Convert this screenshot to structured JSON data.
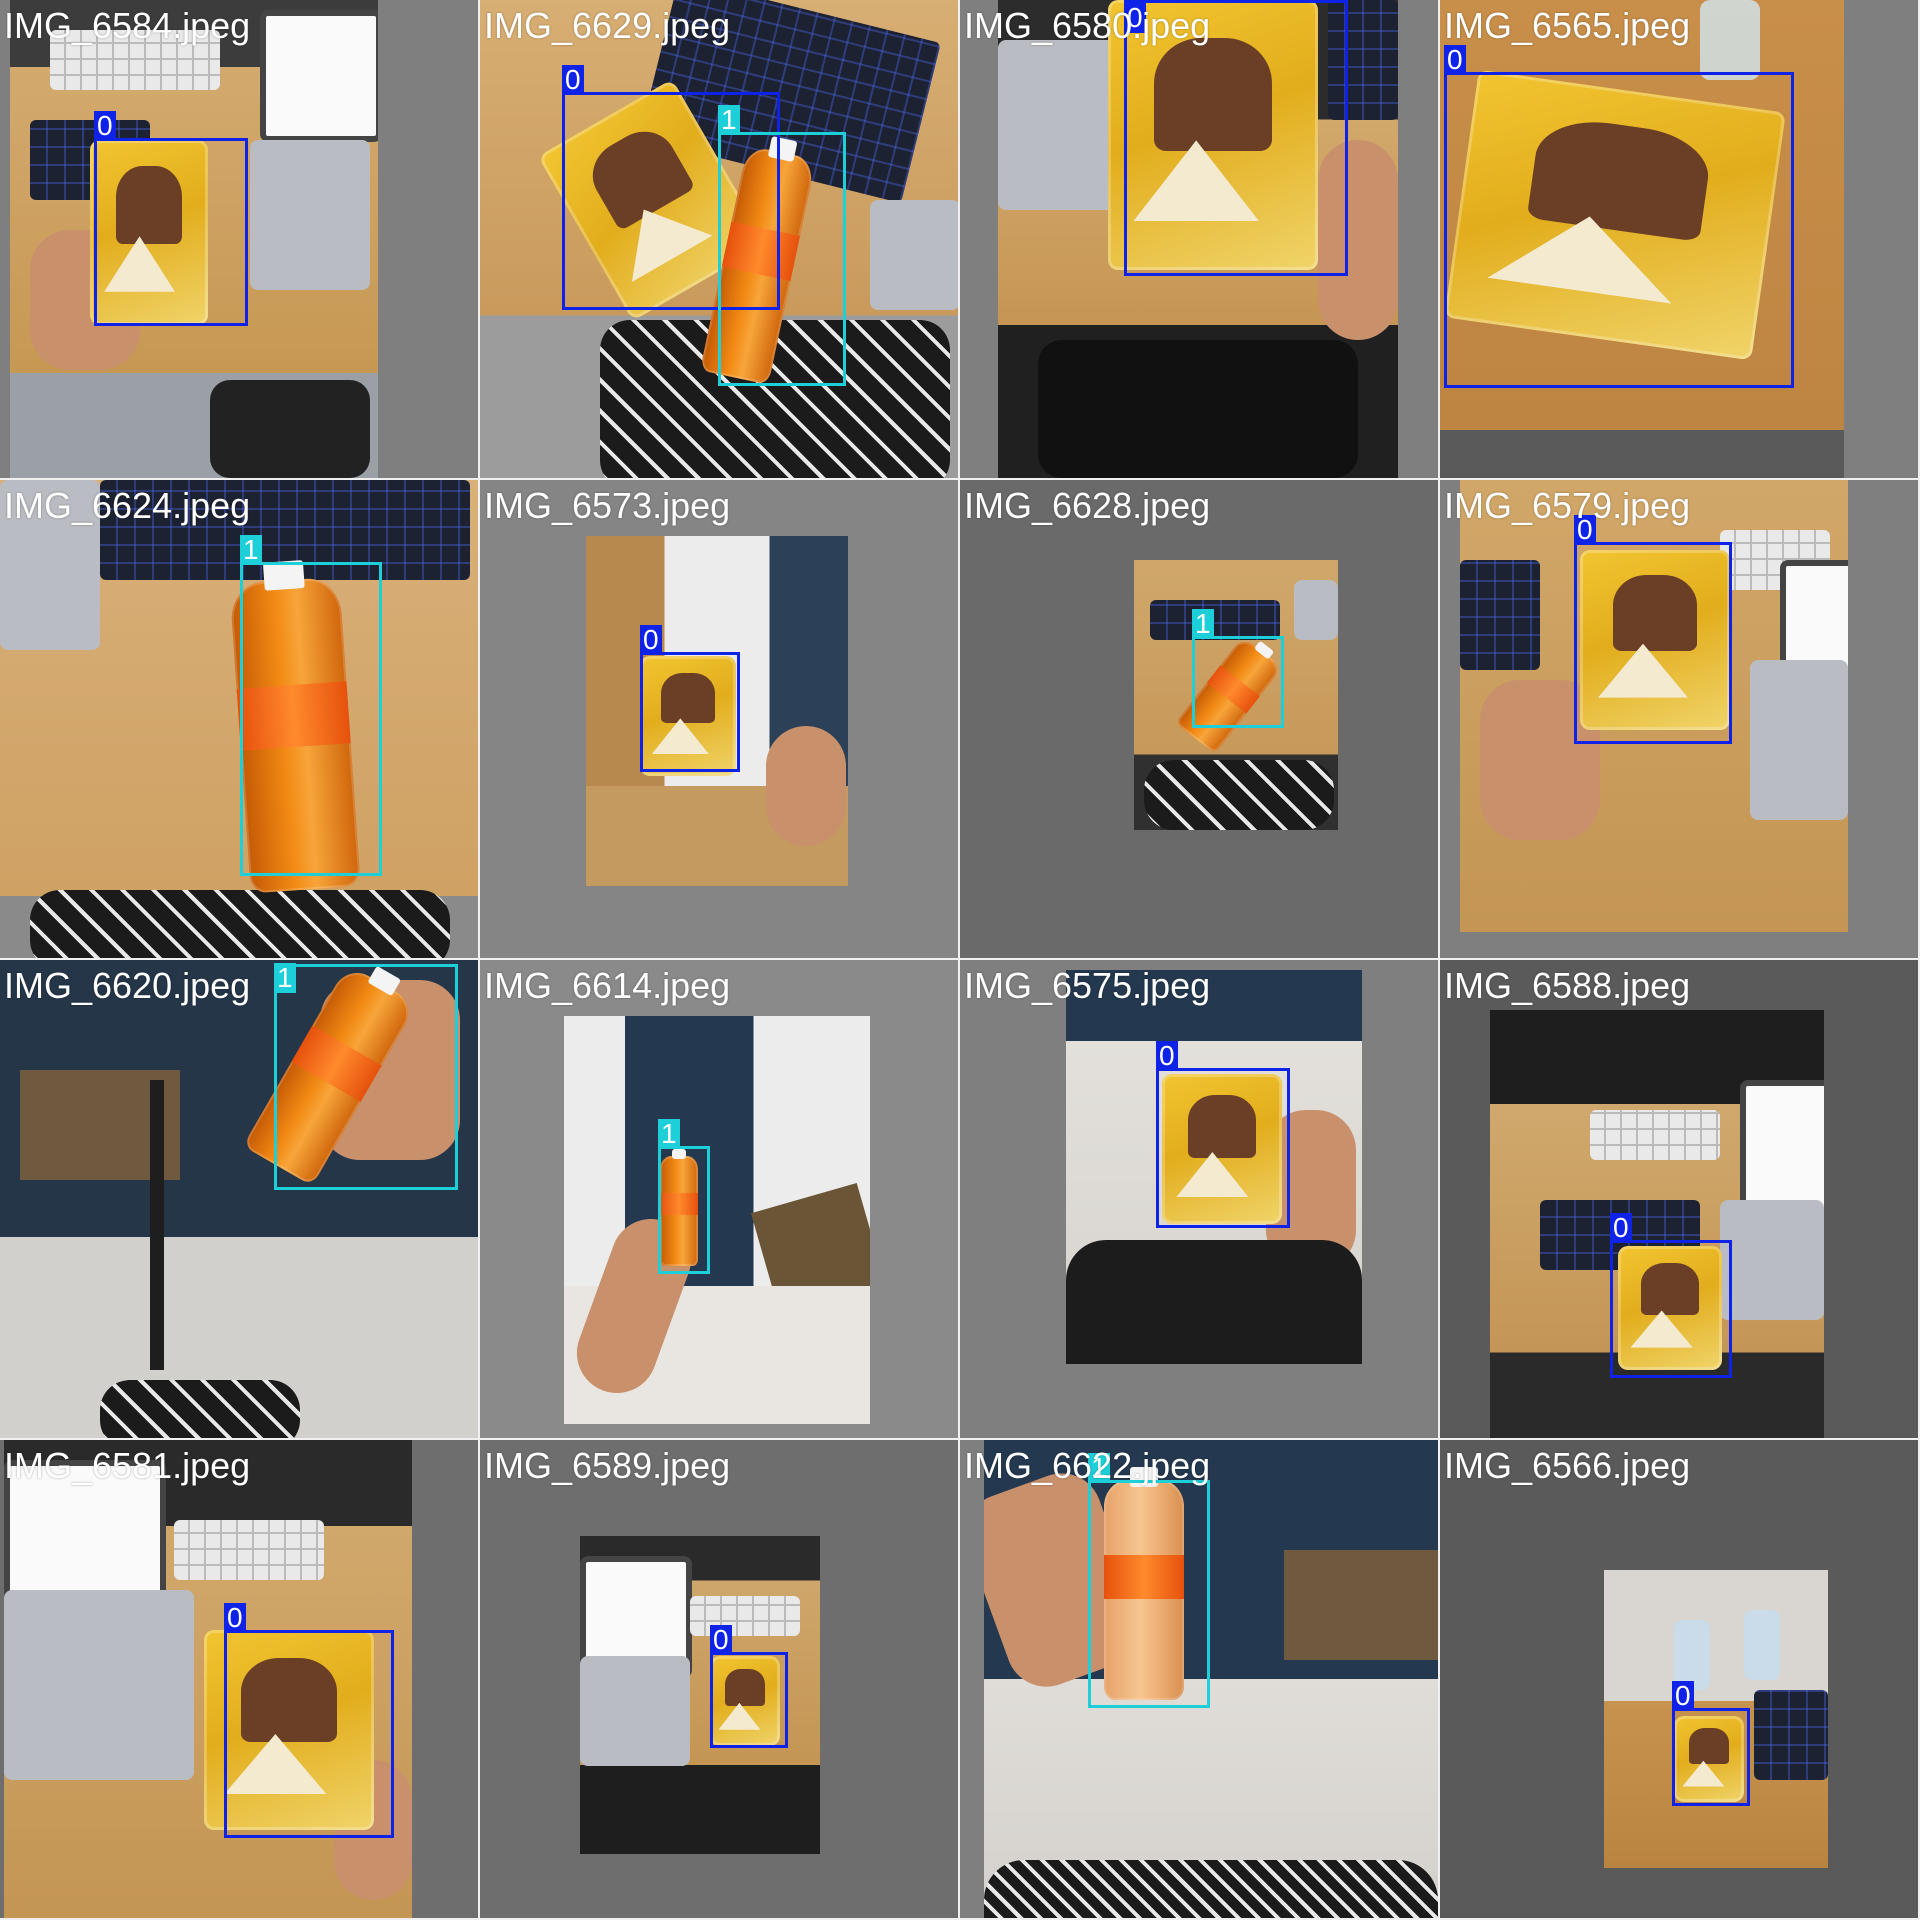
{
  "colors": {
    "class_0_box": "#0f23e8",
    "class_1_box": "#1ccfd8",
    "caption_text": "#ffffff",
    "letterbox_gray": "#7f7f7f"
  },
  "tiles": [
    {
      "filename": "IMG_6584.jpeg",
      "detections": [
        {
          "class_label": "0",
          "class_id": 0
        }
      ]
    },
    {
      "filename": "IMG_6629.jpeg",
      "detections": [
        {
          "class_label": "0",
          "class_id": 0
        },
        {
          "class_label": "1",
          "class_id": 1
        }
      ]
    },
    {
      "filename": "IMG_6580.jpeg",
      "detections": [
        {
          "class_label": "0",
          "class_id": 0
        }
      ]
    },
    {
      "filename": "IMG_6565.jpeg",
      "detections": [
        {
          "class_label": "0",
          "class_id": 0
        }
      ]
    },
    {
      "filename": "IMG_6624.jpeg",
      "detections": [
        {
          "class_label": "1",
          "class_id": 1
        }
      ]
    },
    {
      "filename": "IMG_6573.jpeg",
      "detections": [
        {
          "class_label": "0",
          "class_id": 0
        }
      ]
    },
    {
      "filename": "IMG_6628.jpeg",
      "detections": [
        {
          "class_label": "1",
          "class_id": 1
        }
      ]
    },
    {
      "filename": "IMG_6579.jpeg",
      "detections": [
        {
          "class_label": "0",
          "class_id": 0
        }
      ]
    },
    {
      "filename": "IMG_6620.jpeg",
      "detections": [
        {
          "class_label": "1",
          "class_id": 1
        }
      ]
    },
    {
      "filename": "IMG_6614.jpeg",
      "detections": [
        {
          "class_label": "1",
          "class_id": 1
        }
      ]
    },
    {
      "filename": "IMG_6575.jpeg",
      "detections": [
        {
          "class_label": "0",
          "class_id": 0
        }
      ]
    },
    {
      "filename": "IMG_6588.jpeg",
      "detections": [
        {
          "class_label": "0",
          "class_id": 0
        }
      ]
    },
    {
      "filename": "IMG_6581.jpeg",
      "detections": [
        {
          "class_label": "0",
          "class_id": 0
        }
      ]
    },
    {
      "filename": "IMG_6589.jpeg",
      "detections": [
        {
          "class_label": "0",
          "class_id": 0
        }
      ]
    },
    {
      "filename": "IMG_6622.jpeg",
      "detections": [
        {
          "class_label": "1",
          "class_id": 1
        }
      ]
    },
    {
      "filename": "IMG_6566.jpeg",
      "detections": [
        {
          "class_label": "0",
          "class_id": 0
        }
      ]
    }
  ]
}
